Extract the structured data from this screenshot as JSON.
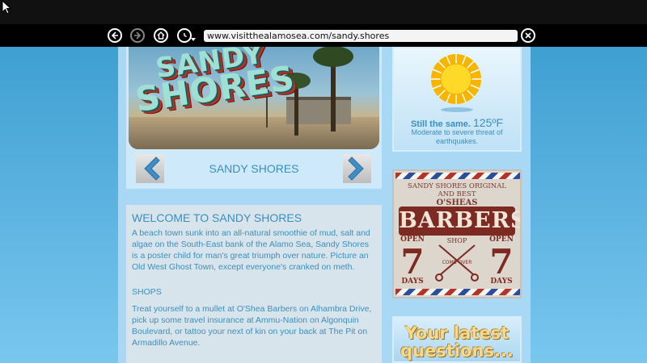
{
  "browser": {
    "url": "www.visitthealamosea.com/sandy.shores",
    "icons": {
      "back": "back-arrow-icon",
      "forward": "forward-arrow-icon",
      "home": "home-icon",
      "history": "clock-icon",
      "close": "close-icon"
    }
  },
  "hero": {
    "logo_line1": "SANDY",
    "logo_line2": "SHORES",
    "caption": "SANDY SHORES"
  },
  "welcome": {
    "title": "WELCOME TO SANDY SHORES",
    "body": "A beach town sunk into an all-natural smoothie of mud, salt and algae on the South-East bank of the Alamo Sea, Sandy Shores is a poster child for man's great triumph over nature. Picture an Old West Ghost Town, except everyone's cranked on meth.",
    "shops_title": "SHOPS",
    "shops_body": "Treat yourself to a mullet at O'Shea Barbers on Alhambra Drive, pick up some travel insurance at Ammu-Nation on Algonquin Boulevard, or tattoo your next of kin on your back at The Pit on Armadillo Avenue."
  },
  "weather": {
    "line1": "Still the same.",
    "temperature": "125ºF",
    "line2": "Moderate to severe threat of earthquakes."
  },
  "barbers_ad": {
    "line1": "SANDY SHORES ORIGINAL",
    "line2": "AND BEST",
    "line3": "O'SHEAS",
    "banner": "BARBERS",
    "shop": "SHOP",
    "open_left": "OPEN",
    "seven_left": "7",
    "days_left": "DAYS",
    "open_right": "OPEN",
    "seven_right": "7",
    "days_right": "DAYS",
    "comb_over": "COMB OVER"
  },
  "questions_ad": {
    "line1": "Your latest",
    "line2": "questions..."
  },
  "colors": {
    "link_blue": "#3a8fbd",
    "barber_red": "#7c2a22",
    "sun_yellow": "#f2c418"
  }
}
